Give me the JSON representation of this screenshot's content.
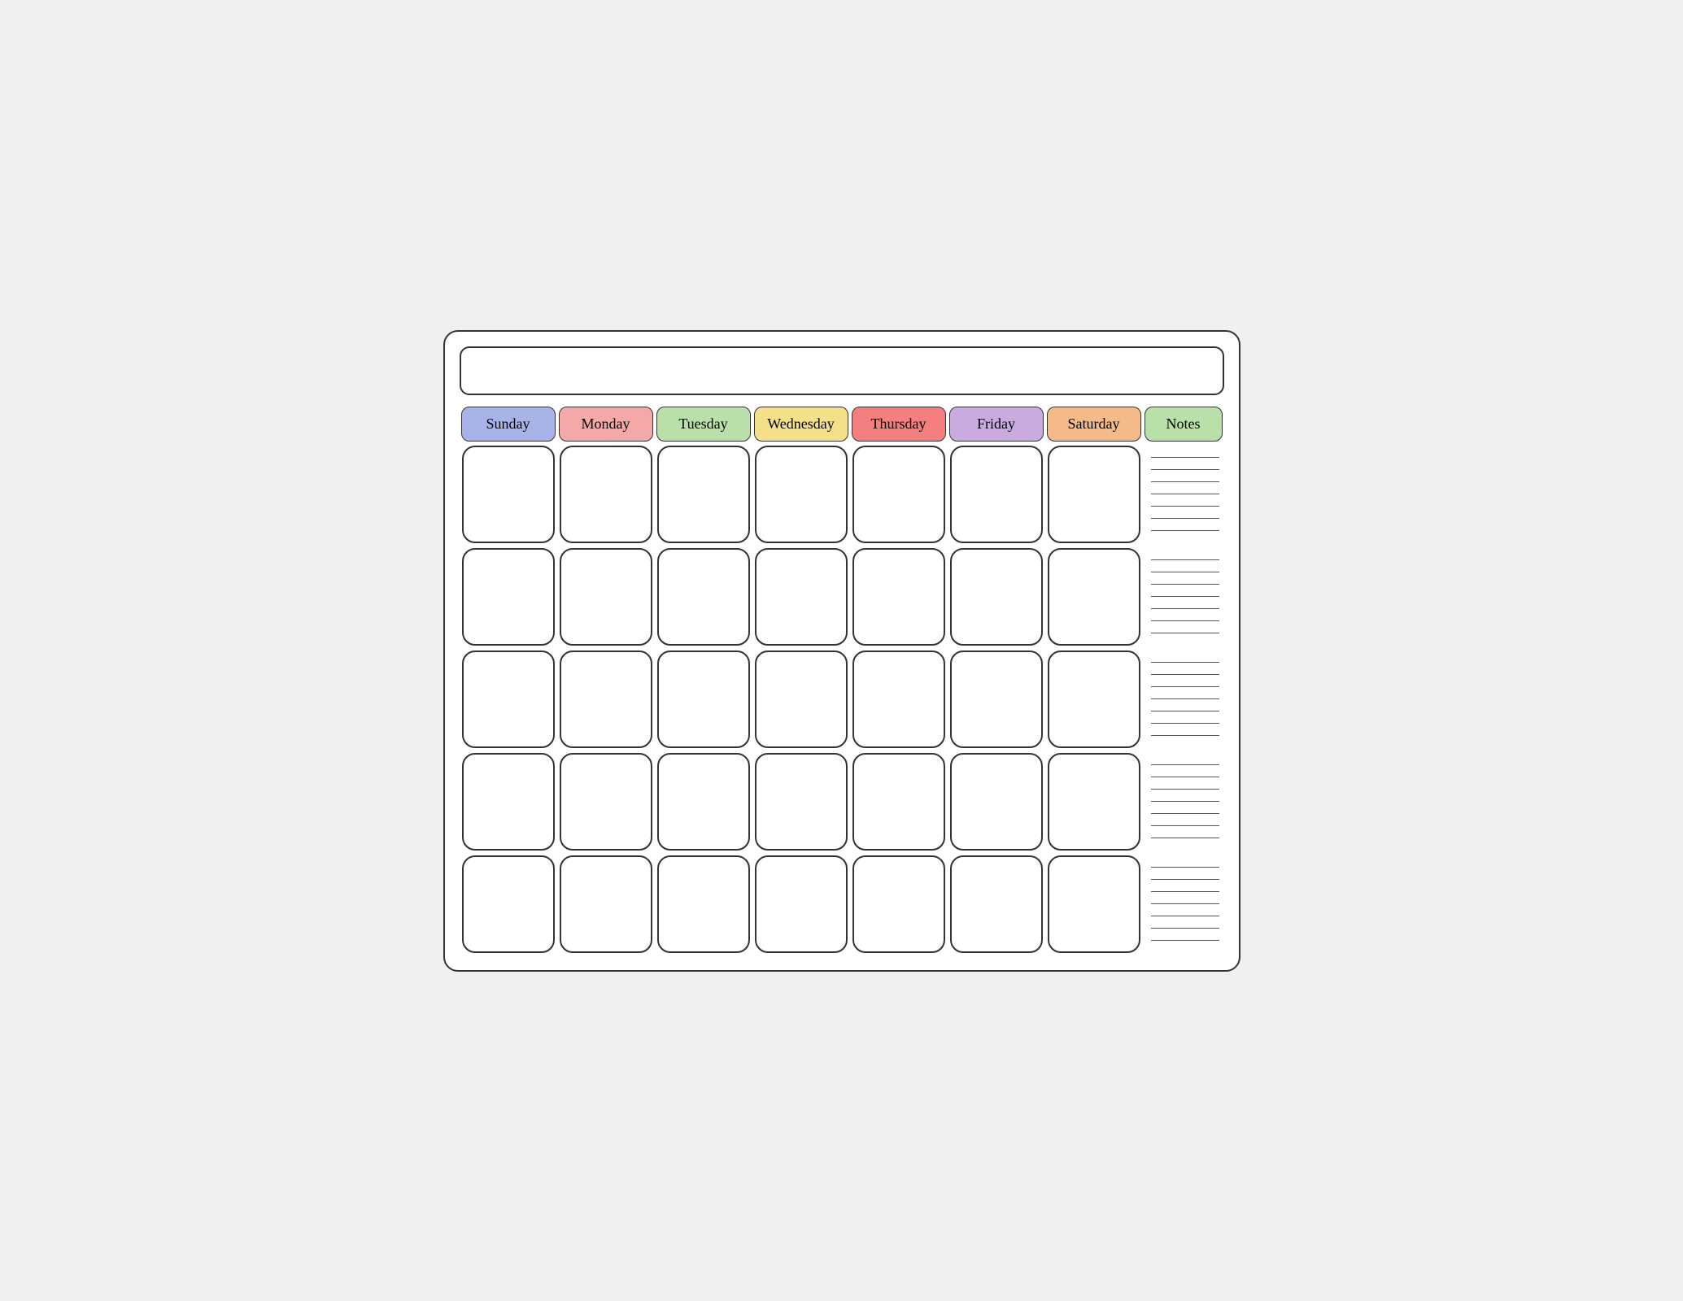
{
  "header": {
    "title": ""
  },
  "days": {
    "headers": [
      {
        "id": "sunday",
        "label": "Sunday",
        "class": "header-sunday"
      },
      {
        "id": "monday",
        "label": "Monday",
        "class": "header-monday"
      },
      {
        "id": "tuesday",
        "label": "Tuesday",
        "class": "header-tuesday"
      },
      {
        "id": "wednesday",
        "label": "Wednesday",
        "class": "header-wednesday"
      },
      {
        "id": "thursday",
        "label": "Thursday",
        "class": "header-thursday"
      },
      {
        "id": "friday",
        "label": "Friday",
        "class": "header-friday"
      },
      {
        "id": "saturday",
        "label": "Saturday",
        "class": "header-saturday"
      }
    ],
    "notes_header": "Notes"
  },
  "rows": 5,
  "cols": 7
}
